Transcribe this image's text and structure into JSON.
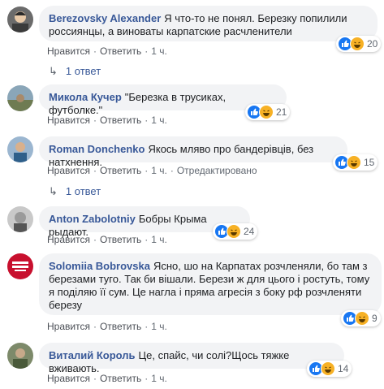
{
  "comments": [
    {
      "author": "Berezovsky Alexander",
      "text": "Я что-то не понял. Березку попилили россиянцы, а виноваты карпатские расчленители",
      "like_label": "Нравится",
      "reply_label": "Ответить",
      "time": "1 ч.",
      "reactions": "20",
      "replies": "1 ответ"
    },
    {
      "author": "Микола Кучер",
      "text": "\"Березка в трусиках, футболке.\"",
      "like_label": "Нравится",
      "reply_label": "Ответить",
      "time": "1 ч.",
      "reactions": "21"
    },
    {
      "author": "Roman Donchenko",
      "text": "Якось мляво про бандерівців, без натхнення.",
      "like_label": "Нравится",
      "reply_label": "Ответить",
      "time": "1 ч.",
      "edited": "Отредактировано",
      "reactions": "15",
      "replies": "1 ответ"
    },
    {
      "author": "Anton Zabolotniy",
      "text": "Бобры Крыма рыдают.",
      "like_label": "Нравится",
      "reply_label": "Ответить",
      "time": "1 ч.",
      "reactions": "24"
    },
    {
      "author": "Solomiia Bobrovska",
      "text": "Ясно, шо на Карпатах розчленяли, бо там з березами туго. Так би вішали. Берези ж для цього і ростуть, тому я поділяю її сум. Це нагла і пряма агресія з боку рф розчленяти березу",
      "like_label": "Нравится",
      "reply_label": "Ответить",
      "time": "1 ч.",
      "reactions": "9"
    },
    {
      "author": "Виталий Король",
      "text": "Це, спайс, чи солі?Щось тяжке вживають.",
      "like_label": "Нравится",
      "reply_label": "Ответить",
      "time": "1 ч.",
      "reactions": "14"
    }
  ],
  "colors": {
    "link": "#385898",
    "bubble": "#f2f3f5",
    "like": "#1877f2",
    "haha": "#f7b125"
  }
}
